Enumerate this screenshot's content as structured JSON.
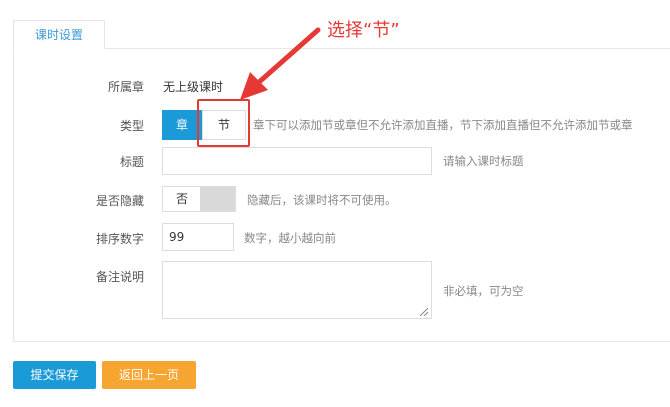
{
  "tab": {
    "label": "课时设置"
  },
  "form": {
    "chapter": {
      "label": "所属章",
      "value": "无上级课时"
    },
    "type": {
      "label": "类型",
      "options": [
        "章",
        "节"
      ],
      "selected": "章",
      "hint": "章下可以添加节或章但不允许添加直播，节下添加直播但不允许添加节或章"
    },
    "title": {
      "label": "标题",
      "value": "",
      "hint": "请输入课时标题"
    },
    "hidden": {
      "label": "是否隐藏",
      "value": "否",
      "hint": "隐藏后，该课时将不可使用。"
    },
    "sort": {
      "label": "排序数字",
      "value": "99",
      "hint": "数字，越小越向前"
    },
    "remark": {
      "label": "备注说明",
      "value": "",
      "hint": "非必填，可为空"
    }
  },
  "buttons": {
    "save": "提交保存",
    "back": "返回上一页"
  },
  "annotation": {
    "text": "选择“节”",
    "color": "#e53935"
  },
  "colors": {
    "primary": "#1a9ad6",
    "secondary": "#f7a531",
    "annotation": "#e53935"
  }
}
